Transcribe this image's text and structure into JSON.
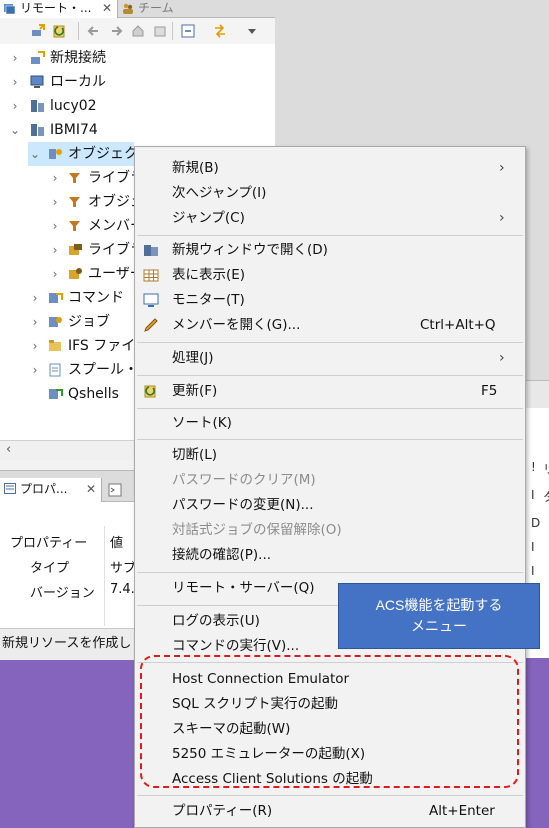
{
  "tabs": {
    "remote": "リモート・...",
    "remote_close": "✕",
    "team": "チーム"
  },
  "tree": {
    "nodes": [
      {
        "label": "新規接続"
      },
      {
        "label": "ローカル"
      },
      {
        "label": "lucy02"
      },
      {
        "label": "IBMI74"
      },
      {
        "label": "オブジェクト"
      },
      {
        "label": "ライブラ"
      },
      {
        "label": "オブジェ"
      },
      {
        "label": "メンバー"
      },
      {
        "label": "ライブラ"
      },
      {
        "label": "ユーザー"
      },
      {
        "label": "コマンド"
      },
      {
        "label": "ジョブ"
      },
      {
        "label": "IFS ファイル"
      },
      {
        "label": "スプール・フ"
      },
      {
        "label": "Qshells"
      }
    ]
  },
  "properties": {
    "tab_label": "プロパ...",
    "tab_close": "✕",
    "headers": {
      "property": "プロパティー",
      "value": "値"
    },
    "rows": [
      {
        "property": "タイプ",
        "value": "サブ"
      },
      {
        "property": "バージョン",
        "value": "7.4."
      }
    ]
  },
  "status_bar": {
    "text": "新規リソースを作成し"
  },
  "right_table": {
    "col1": [
      "!",
      "I",
      "D",
      "I",
      "I"
    ],
    "col2": [
      "リ",
      "タ"
    ]
  },
  "menu": {
    "items": [
      {
        "label": "新規(B)",
        "submenu": true
      },
      {
        "label": "次へジャンプ(I)"
      },
      {
        "label": "ジャンプ(C)",
        "submenu": true
      },
      {
        "label": "新規ウィンドウで開く(D)",
        "icon": "new-window-icon"
      },
      {
        "label": "表に表示(E)",
        "icon": "table-icon"
      },
      {
        "label": "モニター(T)",
        "icon": "monitor-icon"
      },
      {
        "label": "メンバーを開く(G)...",
        "icon": "pencil-icon",
        "accel": "Ctrl+Alt+Q"
      },
      {
        "label": "処理(J)",
        "submenu": true
      },
      {
        "label": "更新(F)",
        "icon": "refresh-icon",
        "accel": "F5"
      },
      {
        "label": "ソート(K)"
      },
      {
        "label": "切断(L)"
      },
      {
        "label": "パスワードのクリア(M)",
        "disabled": true
      },
      {
        "label": "パスワードの変更(N)..."
      },
      {
        "label": "対話式ジョブの保留解除(O)",
        "disabled": true
      },
      {
        "label": "接続の確認(P)..."
      },
      {
        "label": "リモート・サーバー(Q)",
        "submenu": true
      },
      {
        "label": "ログの表示(U)"
      },
      {
        "label": "コマンドの実行(V)..."
      },
      {
        "label": "Host Connection Emulator"
      },
      {
        "label": "SQL スクリプト実行の起動"
      },
      {
        "label": "スキーマの起動(W)"
      },
      {
        "label": "5250 エミュレーターの起動(X)"
      },
      {
        "label": "Access Client Solutions の起動"
      },
      {
        "label": "プロパティー(R)",
        "accel": "Alt+Enter"
      }
    ],
    "submenu_arrow": "›"
  },
  "callout": {
    "line1": "ACS機能を起動する",
    "line2": "メニュー"
  },
  "colors": {
    "background": "#8564bd",
    "callout": "#4472c4",
    "highlight_border": "#e01a1a",
    "selection": "#cce8ff"
  }
}
